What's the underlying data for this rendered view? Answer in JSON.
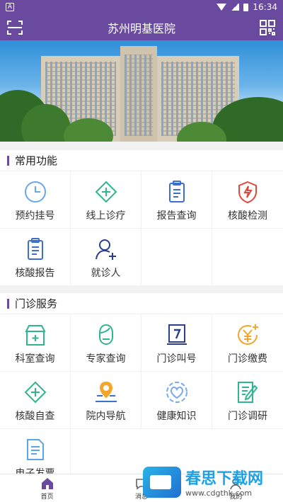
{
  "status_bar": {
    "carrier_badge": "A",
    "time": "16:34"
  },
  "header": {
    "title": "苏州明基医院"
  },
  "sections": [
    {
      "title": "常用功能",
      "items": [
        {
          "label": "预约挂号",
          "icon": "clock-icon"
        },
        {
          "label": "线上诊疗",
          "icon": "medical-cross-icon"
        },
        {
          "label": "报告查询",
          "icon": "report-clipboard-icon"
        },
        {
          "label": "核酸检测",
          "icon": "shield-lightning-icon"
        },
        {
          "label": "核酸报告",
          "icon": "report-clipboard-icon"
        },
        {
          "label": "就诊人",
          "icon": "add-person-icon"
        }
      ]
    },
    {
      "title": "门诊服务",
      "items": [
        {
          "label": "科室查询",
          "icon": "department-icon"
        },
        {
          "label": "专家查询",
          "icon": "doctor-icon"
        },
        {
          "label": "门诊叫号",
          "icon": "calling-number-icon"
        },
        {
          "label": "门诊缴费",
          "icon": "yuan-payment-icon"
        },
        {
          "label": "核酸自查",
          "icon": "medical-cross-icon"
        },
        {
          "label": "院内导航",
          "icon": "map-pin-icon"
        },
        {
          "label": "健康知识",
          "icon": "heart-knowledge-icon"
        },
        {
          "label": "门诊调研",
          "icon": "survey-edit-icon"
        },
        {
          "label": "电子发票",
          "icon": "invoice-icon"
        }
      ]
    }
  ],
  "tabbar": {
    "tabs": [
      {
        "label": "首页"
      },
      {
        "label": "消息"
      },
      {
        "label": "我的"
      }
    ]
  },
  "watermark": {
    "name": "春思下载网",
    "url": "www.cdgthk.com"
  },
  "colors": {
    "brand": "#6a4a9f",
    "accent_green": "#2fb58f",
    "accent_blue": "#3b6fd0",
    "accent_red": "#e2483d",
    "accent_orange": "#f4a52a"
  }
}
